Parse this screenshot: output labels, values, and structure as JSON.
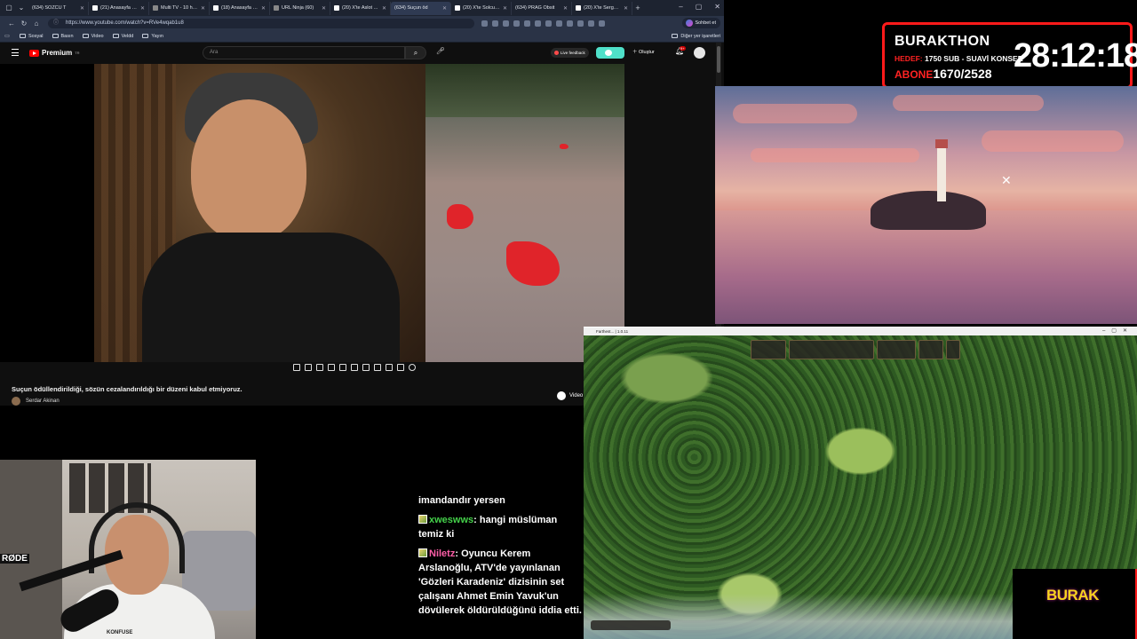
{
  "browser": {
    "tabs": [
      {
        "label": "(634) SÖZCÜ T",
        "favicon": "yt"
      },
      {
        "label": "(21) Anasayfa / X",
        "favicon": "x"
      },
      {
        "label": "Multi TV - 10 haber",
        "favicon": "tv"
      },
      {
        "label": "(18) Anasayfa / X",
        "favicon": "x"
      },
      {
        "label": "URL Ninja (60)",
        "favicon": "tv"
      },
      {
        "label": "(20) X'te Aslot Anal",
        "favicon": "x"
      },
      {
        "label": "(634) Suçun öd",
        "favicon": "yt"
      },
      {
        "label": "(20) X'te Solcu Gaz",
        "favicon": "x"
      },
      {
        "label": "(634) PRAG Obsit",
        "favicon": "yt"
      },
      {
        "label": "(20) X'te Sergen \"A",
        "favicon": "x"
      }
    ],
    "active_tab_index": 6,
    "url": "https://www.youtube.com/watch?v=RVe4wqab1u8",
    "chat_button": "Sohbet et",
    "bookmarks": [
      "Sosyal",
      "Basın",
      "Video",
      "Veldd",
      "Yayın"
    ],
    "other_bookmarks": "Diğer yer işaretleri"
  },
  "youtube": {
    "brand": "Premium",
    "brand_region": "TR",
    "search_placeholder": "Ara",
    "live_feedback": "Live feedback",
    "create_label": "Oluştur",
    "notif_count": "9+",
    "video_title": "Suçun ödüllendirildiği, sözün cezalandırıldığı bir düzeni kabul etmiyoruz.",
    "channel_name": "Serdar Akinan",
    "video_button": "Video"
  },
  "timer": {
    "name": "BURAKTHON",
    "hedef_label": "HEDEF:",
    "hedef_text": "1750 SUB - SUAVİ KONSER",
    "abone_label": "ABONE",
    "abone_value": "1670/2528",
    "clock": "28:12:18"
  },
  "game": {
    "title": "Farthest... | 1.0.11"
  },
  "webcam": {
    "mic_brand": "RØDE",
    "shirt_brand": "KONFUSE"
  },
  "chat": {
    "messages": [
      {
        "user": "",
        "text": "imandandır yersen"
      },
      {
        "user": "xweswws",
        "user_color": "#44d04a",
        "text": "hangi müslüman temiz ki"
      },
      {
        "user": "Niletz",
        "user_color": "#ff5fa8",
        "text": "Oyuncu Kerem Arslanoğlu, ATV'de yayınlanan 'Gözleri Karadeniz' dizisinin set çalışanı Ahmet Emin Yavuk'un dövülerek öldürüldüğünü iddia etti."
      }
    ]
  },
  "logo": {
    "text": "BURAK"
  },
  "colors": {
    "accent_red": "#ff1a1a",
    "yt_red": "#ff0000",
    "logo_yellow": "#f6d21f"
  }
}
